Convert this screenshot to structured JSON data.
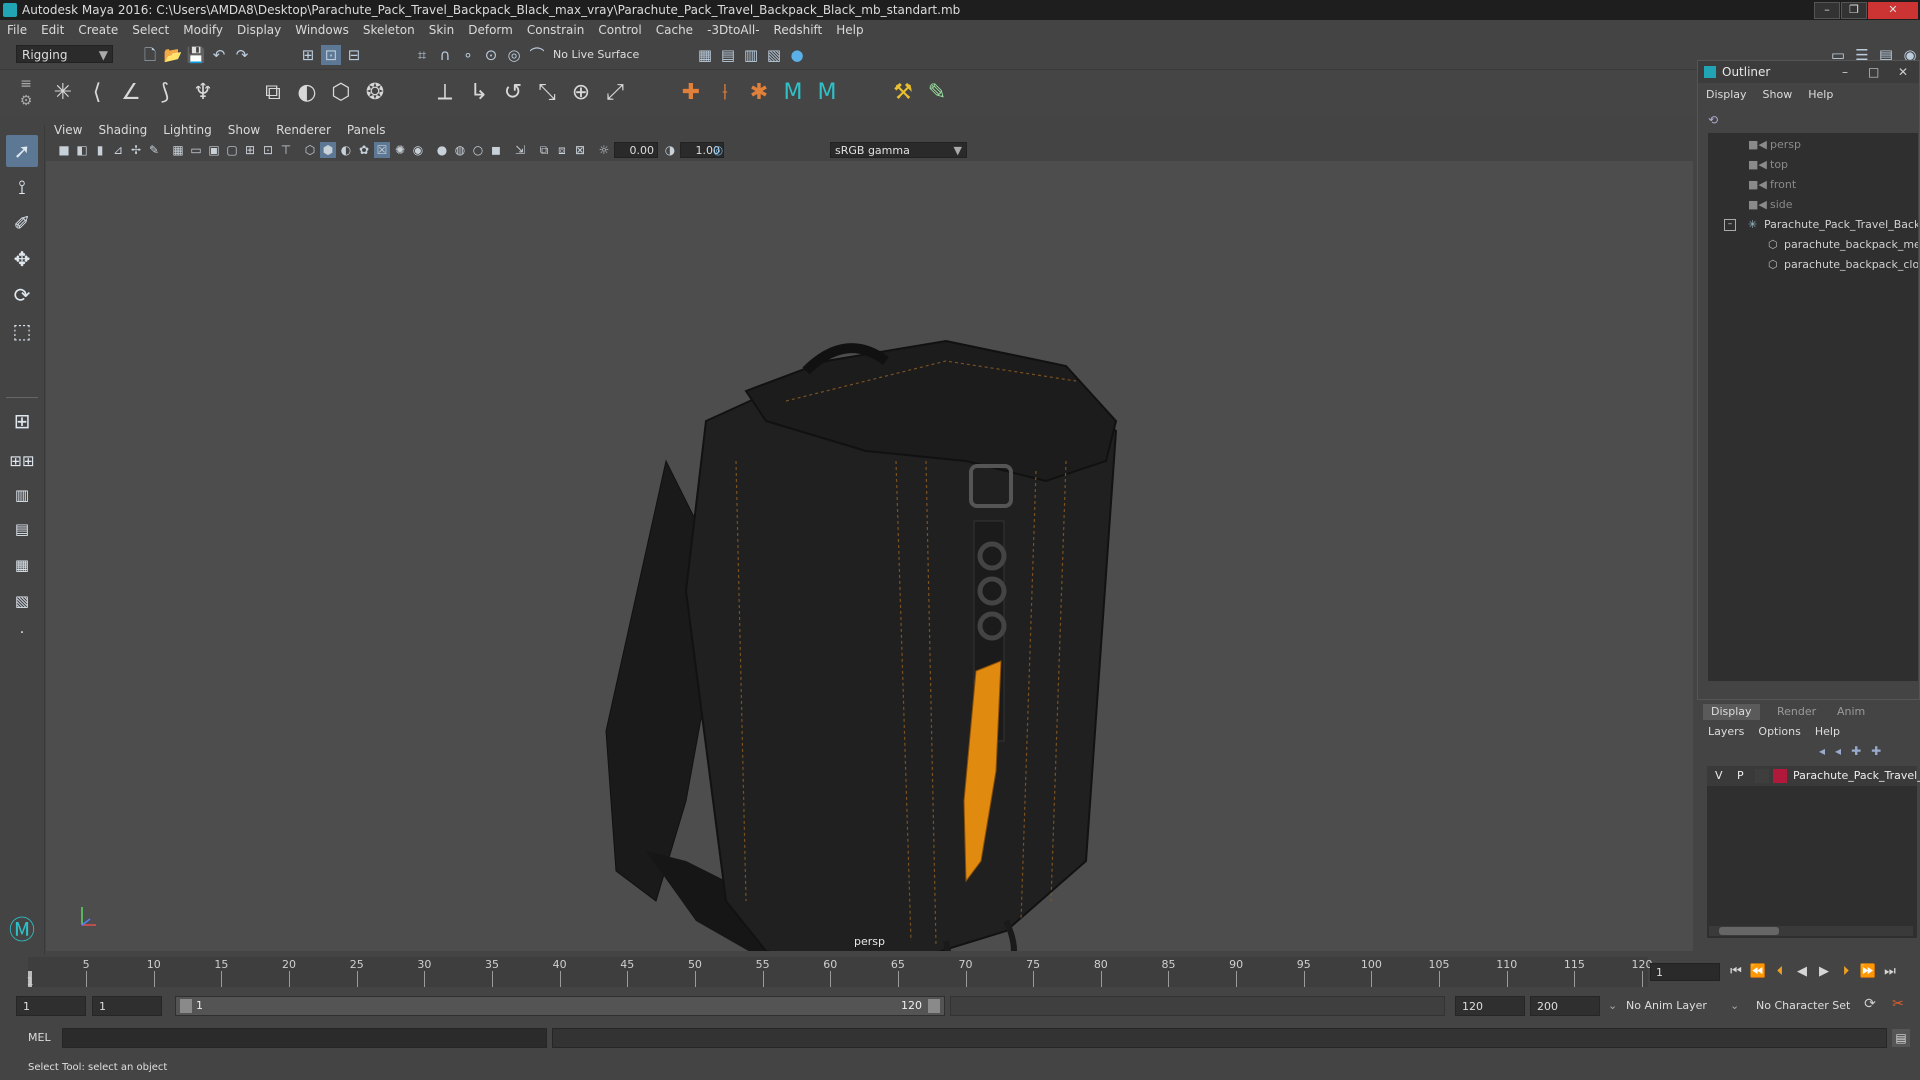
{
  "window": {
    "title": "Autodesk Maya 2016: C:\\Users\\AMDA8\\Desktop\\Parachute_Pack_Travel_Backpack_Black_max_vray\\Parachute_Pack_Travel_Backpack_Black_mb_standart.mb"
  },
  "menubar": [
    "File",
    "Edit",
    "Create",
    "Select",
    "Modify",
    "Display",
    "Windows",
    "Skeleton",
    "Skin",
    "Deform",
    "Constrain",
    "Control",
    "Cache",
    "-3DtoAll-",
    "Redshift",
    "Help"
  ],
  "statusline": {
    "mode": "Rigging",
    "live_surface": "No Live Surface"
  },
  "panel": {
    "menus": [
      "View",
      "Shading",
      "Lighting",
      "Show",
      "Renderer",
      "Panels"
    ],
    "exposure": "0.00",
    "gamma": "1.00",
    "color_space": "sRGB gamma",
    "camera": "persp"
  },
  "outliner": {
    "title": "Outliner",
    "menus": [
      "Display",
      "Show",
      "Help"
    ],
    "items": [
      {
        "label": "persp",
        "kind": "camera"
      },
      {
        "label": "top",
        "kind": "camera"
      },
      {
        "label": "front",
        "kind": "camera"
      },
      {
        "label": "side",
        "kind": "camera"
      },
      {
        "label": "Parachute_Pack_Travel_Backp",
        "kind": "group"
      },
      {
        "label": "parachute_backpack_met",
        "kind": "mesh"
      },
      {
        "label": "parachute_backpack_clot",
        "kind": "mesh"
      }
    ]
  },
  "layers": {
    "tabs": [
      "Display",
      "Render",
      "Anim"
    ],
    "menus": [
      "Layers",
      "Options",
      "Help"
    ],
    "layer": {
      "v": "V",
      "p": "P",
      "name": "Parachute_Pack_Travel_",
      "color": "#b0193a"
    }
  },
  "timeline": {
    "ticks": [
      "5",
      "10",
      "15",
      "20",
      "25",
      "30",
      "35",
      "40",
      "45",
      "50",
      "55",
      "60",
      "65",
      "70",
      "75",
      "80",
      "85",
      "90",
      "95",
      "100",
      "105",
      "110",
      "115",
      "120"
    ],
    "start_marker": "1",
    "current_frame": "1"
  },
  "range": {
    "start": "1",
    "playback_start": "1",
    "bar_start": "1",
    "bar_end": "120",
    "playback_end": "120",
    "end": "200",
    "anim_layer": "No Anim Layer",
    "character_set": "No Character Set"
  },
  "command": {
    "label": "MEL"
  },
  "help": {
    "text": "Select Tool: select an object"
  },
  "colors": {
    "accent_strap": "#e08a10",
    "layer_color": "#b0193a",
    "active_tool": "#5d7894"
  }
}
